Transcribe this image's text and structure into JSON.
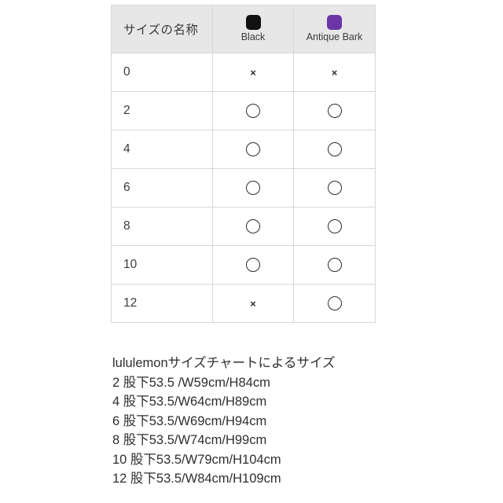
{
  "table": {
    "columns": [
      {
        "key": "size_name",
        "header": "サイズの名称",
        "type": "text"
      },
      {
        "key": "black",
        "header": "Black",
        "type": "swatch",
        "swatch_color": "#111111",
        "swatch_icon": "color-swatch-icon"
      },
      {
        "key": "antique_bark",
        "header": "Antique Bark",
        "type": "swatch",
        "swatch_color": "#6a35a6",
        "swatch_icon": "color-swatch-icon"
      }
    ],
    "availability_symbols": {
      "available": "○",
      "unavailable": "×"
    },
    "rows": [
      {
        "size": "0",
        "black": "unavailable",
        "antique_bark": "unavailable"
      },
      {
        "size": "2",
        "black": "available",
        "antique_bark": "available"
      },
      {
        "size": "4",
        "black": "available",
        "antique_bark": "available"
      },
      {
        "size": "6",
        "black": "available",
        "antique_bark": "available"
      },
      {
        "size": "8",
        "black": "available",
        "antique_bark": "available"
      },
      {
        "size": "10",
        "black": "available",
        "antique_bark": "available"
      },
      {
        "size": "12",
        "black": "unavailable",
        "antique_bark": "available"
      }
    ]
  },
  "notes": {
    "title": "lululemonサイズチャートによるサイズ",
    "lines": [
      "2 股下53.5 /W59cm/H84cm",
      "4 股下53.5/W64cm/H89cm",
      "6 股下53.5/W69cm/H94cm",
      "8 股下53.5/W74cm/H99cm",
      "10 股下53.5/W79cm/H104cm",
      "12 股下53.5/W84cm/H109cm"
    ]
  },
  "colors": {
    "page_background": "#ffffff",
    "header_background": "#e7e7e7",
    "border": "#d8d8d8",
    "text": "#2e2e2e",
    "black_swatch": "#111111",
    "antique_bark_swatch": "#6a35a6"
  }
}
